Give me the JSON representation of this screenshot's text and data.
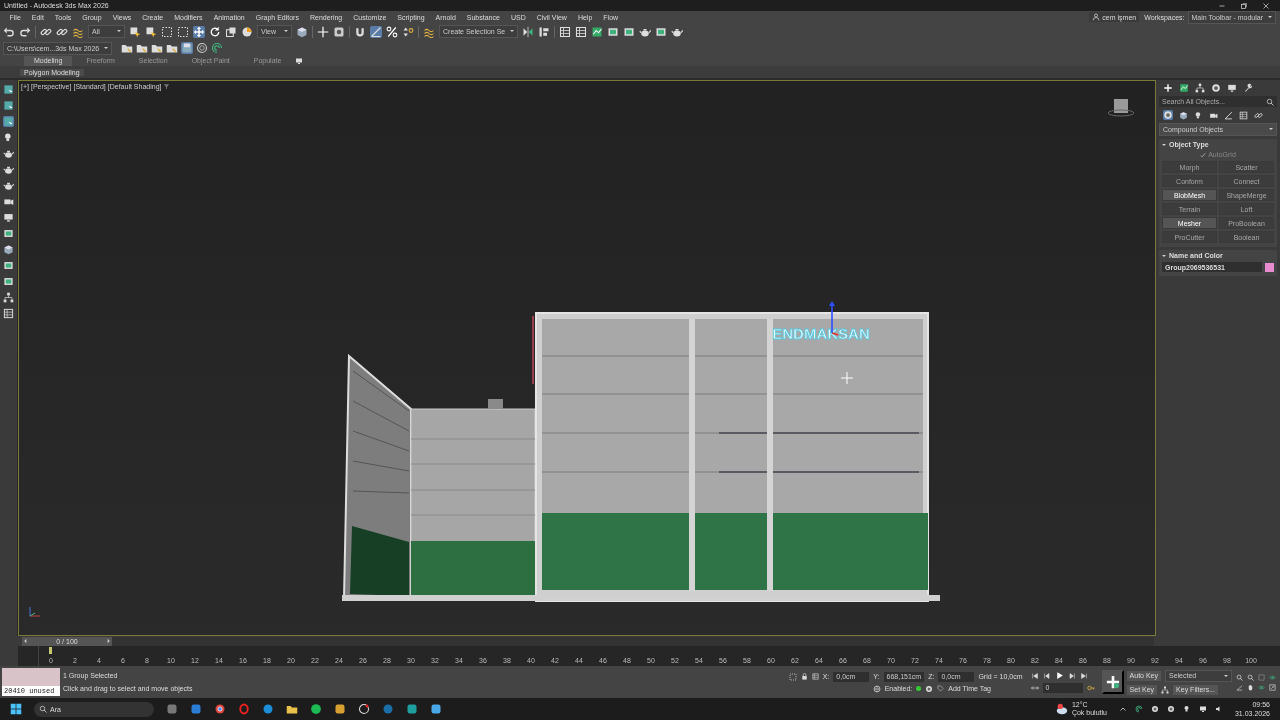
{
  "window": {
    "title": "Untitled - Autodesk 3ds Max 2026"
  },
  "menu": [
    "File",
    "Edit",
    "Tools",
    "Group",
    "Views",
    "Create",
    "Modifiers",
    "Animation",
    "Graph Editors",
    "Rendering",
    "Customize",
    "Scripting",
    "Arnold",
    "Substance",
    "USD",
    "Civil View",
    "Help",
    "Flow"
  ],
  "account": {
    "user": "cem işmen",
    "workspaces_label": "Workspaces:",
    "workspace": "Main Toolbar - modular"
  },
  "main_toolbar": {
    "selection_filter": "All",
    "reference_coords": "View",
    "named_selection": "Create Selection Se"
  },
  "project_path": "C:\\Users\\cem...3ds Max 2026",
  "ribbon": {
    "tabs": [
      {
        "label": "Modeling",
        "selected": true
      },
      {
        "label": "Freeform",
        "selected": false
      },
      {
        "label": "Selection",
        "selected": false
      },
      {
        "label": "Object Paint",
        "selected": false
      },
      {
        "label": "Populate",
        "selected": false
      }
    ],
    "panel": "Polygon Modeling"
  },
  "viewport": {
    "labels": [
      "[+]",
      "[Perspective]",
      "[Standard]",
      "[Default Shading]"
    ],
    "sign_text": "ENDMAKSAN"
  },
  "command_panel": {
    "search_placeholder": "Search All Objects...",
    "category": "Compound Objects",
    "object_type": {
      "title": "Object Type",
      "autogrid": {
        "label": "AutoGrid",
        "checked": true
      },
      "buttons": [
        {
          "label": "Morph",
          "disabled": true
        },
        {
          "label": "Scatter",
          "disabled": true
        },
        {
          "label": "Conform",
          "disabled": true
        },
        {
          "label": "Connect",
          "disabled": true
        },
        {
          "label": "BlobMesh",
          "disabled": false
        },
        {
          "label": "ShapeMerge",
          "disabled": true
        },
        {
          "label": "Terrain",
          "disabled": true
        },
        {
          "label": "Loft",
          "disabled": true
        },
        {
          "label": "Mesher",
          "disabled": false
        },
        {
          "label": "ProBoolean",
          "disabled": true
        },
        {
          "label": "ProCutter",
          "disabled": true
        },
        {
          "label": "Boolean",
          "disabled": true
        }
      ]
    },
    "name_and_color": {
      "title": "Name and Color",
      "name": "Group2069536531",
      "color": "#e98ccf"
    }
  },
  "timeline": {
    "position": "0 / 100",
    "ticks": [
      "0",
      "2",
      "4",
      "6",
      "8",
      "10",
      "12",
      "14",
      "16",
      "18",
      "20",
      "22",
      "24",
      "26",
      "28",
      "30",
      "32",
      "34",
      "36",
      "38",
      "40",
      "42",
      "44",
      "46",
      "48",
      "50",
      "52",
      "54",
      "56",
      "58",
      "60",
      "62",
      "64",
      "66",
      "68",
      "70",
      "72",
      "74",
      "76",
      "78",
      "80",
      "82",
      "84",
      "86",
      "88",
      "90",
      "92",
      "94",
      "96",
      "98",
      "100"
    ]
  },
  "status": {
    "script_listener": "20410 unused",
    "selection": "1 Group Selected",
    "prompt": "Click and drag to select and move objects",
    "x_label": "X:",
    "x": "0,0cm",
    "y_label": "Y:",
    "y": "668,151cm",
    "z_label": "Z:",
    "z": "0,0cm",
    "grid": "Grid = 10,0cm",
    "enabled_label": "Enabled:",
    "time_tag": "Add Time Tag",
    "auto_key": "Auto Key",
    "key_mode": "Selected",
    "set_key": "Set Key",
    "key_filters": "Key Filters...",
    "frame": "0"
  },
  "taskbar": {
    "search_placeholder": "Ara",
    "weather": {
      "temp": "12°C",
      "desc": "Çok bulutlu"
    },
    "time": "09:56",
    "date": "31.03.2026"
  }
}
